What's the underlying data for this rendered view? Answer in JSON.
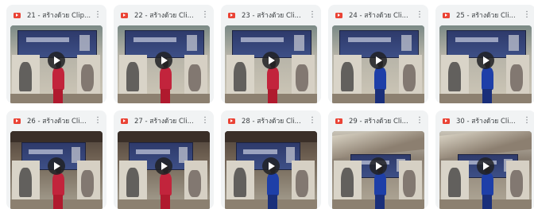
{
  "files": [
    {
      "title": "21 - สร้างด้วย Clip...",
      "scene": "indoor",
      "outfit": "#c2243c",
      "shorts": "#b01a2e"
    },
    {
      "title": "22 - สร้างด้วย Cli...",
      "scene": "indoor",
      "outfit": "#c2243c",
      "shorts": "#b01a2e"
    },
    {
      "title": "23 - สร้างด้วย Cli...",
      "scene": "indoor",
      "outfit": "#c2243c",
      "shorts": "#b01a2e"
    },
    {
      "title": "24 - สร้างด้วย Cli...",
      "scene": "indoor",
      "outfit": "#1e3fa8",
      "shorts": "#1a2f7a"
    },
    {
      "title": "25 - สร้างด้วย Cli...",
      "scene": "indoor",
      "outfit": "#1e3fa8",
      "shorts": "#1a2f7a"
    },
    {
      "title": "26 - สร้างด้วย Cli...",
      "scene": "gym",
      "outfit": "#c2243c",
      "shorts": "#b01a2e"
    },
    {
      "title": "27 - สร้างด้วย Cli...",
      "scene": "gym",
      "outfit": "#c2243c",
      "shorts": "#b01a2e"
    },
    {
      "title": "28 - สร้างด้วย Cli...",
      "scene": "gym",
      "outfit": "#1e3fa8",
      "shorts": "#1a2f7a"
    },
    {
      "title": "29 - สร้างด้วย Cli...",
      "scene": "roof",
      "outfit": "#1e3fa8",
      "shorts": "#1a2f7a"
    },
    {
      "title": "30 - สร้างด้วย Cli...",
      "scene": "roof",
      "outfit": "#1e3fa8",
      "shorts": "#1a2f7a"
    }
  ],
  "icons": {
    "file_type": "video-file-icon",
    "menu": "more-vert-icon",
    "play": "play-icon"
  },
  "colors": {
    "file_icon": "#ea4335",
    "card_bg": "#f1f3f4"
  }
}
